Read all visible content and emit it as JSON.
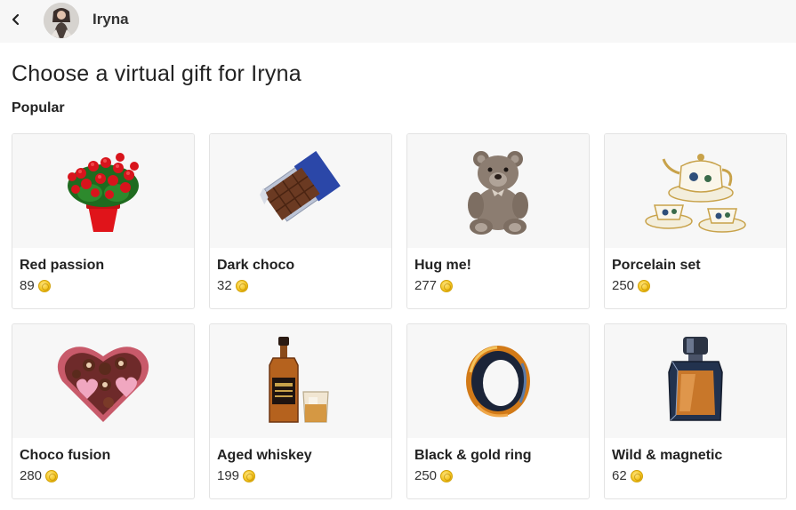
{
  "header": {
    "user_name": "Iryna"
  },
  "page": {
    "title": "Choose a virtual gift for Iryna",
    "section": "Popular"
  },
  "gifts": [
    {
      "name": "Red passion",
      "price": "89",
      "icon": "red-roses-icon"
    },
    {
      "name": "Dark choco",
      "price": "32",
      "icon": "chocolate-bar-icon"
    },
    {
      "name": "Hug me!",
      "price": "277",
      "icon": "teddy-bear-icon"
    },
    {
      "name": "Porcelain set",
      "price": "250",
      "icon": "tea-set-icon"
    },
    {
      "name": "Choco fusion",
      "price": "280",
      "icon": "heart-chocolate-box-icon"
    },
    {
      "name": "Aged whiskey",
      "price": "199",
      "icon": "whiskey-bottle-icon"
    },
    {
      "name": "Black & gold ring",
      "price": "250",
      "icon": "ring-icon"
    },
    {
      "name": "Wild & magnetic",
      "price": "62",
      "icon": "perfume-bottle-icon"
    }
  ],
  "colors": {
    "topbar_bg": "#f7f7f7",
    "card_border": "#e3e3e3",
    "coin": "#f3c21b"
  }
}
